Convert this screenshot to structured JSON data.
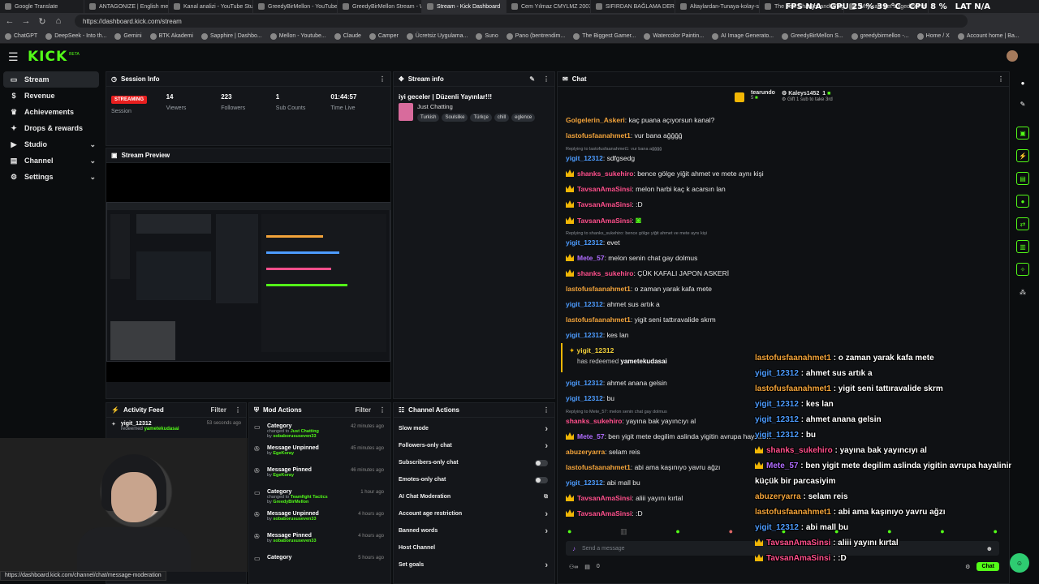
{
  "browser": {
    "tabs": [
      {
        "label": "Google Translate",
        "active": false
      },
      {
        "label": "ANTAGONIZE | English mea",
        "active": false
      },
      {
        "label": "Kanal analizi - YouTube Stud",
        "active": false
      },
      {
        "label": "GreedyBirMellon - YouTube",
        "active": false
      },
      {
        "label": "GreedyBirMellon Stream - W",
        "active": false
      },
      {
        "label": "Stream - Kick Dashboard",
        "active": true
      },
      {
        "label": "Cem Yılmaz CMYLMZ 2007",
        "active": false
      },
      {
        "label": "SIFIRDAN BAĞLAMA DERSİ",
        "active": false
      },
      {
        "label": "Altaylardan-Tunaya-kolay-s",
        "active": false
      },
      {
        "label": "The best ChatBot and Widg",
        "active": false
      },
      {
        "label": "Why cats get singed but sti",
        "active": false
      }
    ],
    "url": "https://dashboard.kick.com/stream",
    "bookmarks": [
      "ChatGPT",
      "DeepSeek - Into th...",
      "Gemini",
      "BTK Akademi",
      "Sapphire | Dashbo...",
      "Mellon - Youtube...",
      "Claude",
      "Camper",
      "Ücretsiz Uygulama...",
      "Suno",
      "Pano (bentrendim...",
      "The Biggest Gamer...",
      "Watercolor Paintin...",
      "AI Image Generato...",
      "GreedyBirMellon S...",
      "greedybirmellon -...",
      "Home / X",
      "Account home | Ba..."
    ],
    "status_url": "https://dashboard.kick.com/channel/chat/message-moderation"
  },
  "osd": {
    "fps": "FPS N/A",
    "gpu": "GPU 25 % 39 °C",
    "cpu": "CPU 8 %",
    "lat": "LAT N/A"
  },
  "app": {
    "logo": "KICK",
    "beta": "BETA"
  },
  "sidebar": {
    "items": [
      {
        "label": "Stream",
        "icon": "screen-icon",
        "active": true
      },
      {
        "label": "Revenue",
        "icon": "dollar-icon"
      },
      {
        "label": "Achievements",
        "icon": "trophy-icon"
      },
      {
        "label": "Drops & rewards",
        "icon": "gift-icon"
      },
      {
        "label": "Studio",
        "icon": "studio-icon",
        "chevron": true
      },
      {
        "label": "Channel",
        "icon": "channel-icon",
        "chevron": true
      },
      {
        "label": "Settings",
        "icon": "gear-icon",
        "chevron": true
      }
    ]
  },
  "session": {
    "title": "Session Info",
    "badge": "STREAMING",
    "session_label": "Session",
    "stats": [
      {
        "value": "14",
        "label": "Viewers"
      },
      {
        "value": "223",
        "label": "Followers"
      },
      {
        "value": "1",
        "label": "Sub Counts"
      },
      {
        "value": "01:44:57",
        "label": "Time Live"
      }
    ]
  },
  "preview": {
    "title": "Stream Preview"
  },
  "stream_info": {
    "title": "Stream info",
    "stream_title": "iyi geceler | Düzenli Yayınlar!!!",
    "category": "Just Chatting",
    "tags": [
      "Turkish",
      "Soulslike",
      "Türkçe",
      "chill",
      "eglence"
    ]
  },
  "activity_feed": {
    "title": "Activity Feed",
    "filter": "Filter",
    "items": [
      {
        "user": "yigit_12312",
        "action": "redeemed",
        "reward": "yametekudasai",
        "time": "53 seconds ago"
      }
    ]
  },
  "mod_actions": {
    "title": "Mod Actions",
    "filter": "Filter",
    "items": [
      {
        "title": "Category",
        "line1": "changed to",
        "value": "Just Chatting",
        "by": "by",
        "user": "sobaborususeven33",
        "time": "42 minutes ago"
      },
      {
        "title": "Message Unpinned",
        "line1": "",
        "value": "",
        "by": "by",
        "user": "EgeKoray",
        "time": "45 minutes ago"
      },
      {
        "title": "Message Pinned",
        "line1": "",
        "value": "",
        "by": "by",
        "user": "EgeKoray",
        "time": "46 minutes ago"
      },
      {
        "title": "Category",
        "line1": "changed to",
        "value": "Teamfight Tactics",
        "by": "by",
        "user": "GreedyBirMellon",
        "time": "1 hour ago"
      },
      {
        "title": "Message Unpinned",
        "line1": "",
        "value": "",
        "by": "by",
        "user": "sobaborususeven33",
        "time": "4 hours ago"
      },
      {
        "title": "Message Pinned",
        "line1": "",
        "value": "",
        "by": "by",
        "user": "sobaborususeven33",
        "time": "4 hours ago"
      },
      {
        "title": "Category",
        "line1": "",
        "value": "",
        "by": "",
        "user": "",
        "time": "5 hours ago"
      }
    ]
  },
  "channel_actions": {
    "title": "Channel Actions",
    "items": [
      {
        "label": "Slow mode",
        "control": "chevron"
      },
      {
        "label": "Followers-only chat",
        "control": "chevron"
      },
      {
        "label": "Subscribers-only chat",
        "control": "toggle"
      },
      {
        "label": "Emotes-only chat",
        "control": "toggle"
      },
      {
        "label": "AI Chat Moderation",
        "control": "external"
      },
      {
        "label": "Account age restriction",
        "control": "chevron"
      },
      {
        "label": "Banned words",
        "control": "chevron"
      },
      {
        "label": "Host Channel",
        "control": "none"
      },
      {
        "label": "Set goals",
        "control": "chevron"
      }
    ]
  },
  "chat": {
    "title": "Chat",
    "top_gifters": [
      {
        "name": "tearundo",
        "count": "5"
      },
      {
        "name": "Kaleys1452",
        "count": "1"
      }
    ],
    "gift_text": "Gift 1 sub to take 3rd",
    "messages": [
      {
        "crown": false,
        "user": "Golgelerin_Askeri",
        "color": "orange",
        "text": "kaç puana açıyorsun kanal?",
        "reply": ""
      },
      {
        "crown": false,
        "user": "lastofusfaanahmet1",
        "color": "orange",
        "text": "vur bana ağğğğ",
        "reply": ""
      },
      {
        "crown": false,
        "user": "yigit_12312",
        "color": "blue",
        "text": "sdfgsedg",
        "reply": "Replying to lastofusfaanahmet1: vur bana ağğğğ"
      },
      {
        "crown": true,
        "user": "shanks_sukehiro",
        "color": "pink",
        "text": "bence gölge yiğit ahmet ve mete aynı kişi",
        "reply": ""
      },
      {
        "crown": true,
        "user": "TavsanAmaSinsi",
        "color": "pink",
        "text": "melon harbi kaç k acarsın lan",
        "reply": ""
      },
      {
        "crown": true,
        "user": "TavsanAmaSinsi",
        "color": "pink",
        "text": ":D",
        "reply": ""
      },
      {
        "crown": true,
        "user": "TavsanAmaSinsi",
        "color": "pink",
        "text": "",
        "reply": ""
      },
      {
        "crown": false,
        "user": "yigit_12312",
        "color": "blue",
        "text": "evet",
        "reply": "Replying to shanks_sukehiro: bence gölge yiğit ahmet ve mete aynı kişi"
      },
      {
        "crown": true,
        "user": "Mete_57",
        "color": "purple",
        "text": "melon senin chat gay dolmus",
        "reply": ""
      },
      {
        "crown": true,
        "user": "shanks_sukehiro",
        "color": "pink",
        "text": "ÇÜK KAFALI JAPON ASKERİ",
        "reply": ""
      },
      {
        "crown": false,
        "user": "lastofusfaanahmet1",
        "color": "orange",
        "text": "o zaman yarak kafa mete",
        "reply": ""
      },
      {
        "crown": false,
        "user": "yigit_12312",
        "color": "blue",
        "text": "ahmet sus artık a",
        "reply": ""
      },
      {
        "crown": false,
        "user": "lastofusfaanahmet1",
        "color": "orange",
        "text": "yigit seni tattıravalide skrm",
        "reply": ""
      },
      {
        "crown": false,
        "user": "yigit_12312",
        "color": "blue",
        "text": "kes lan",
        "reply": ""
      }
    ],
    "redeem": {
      "user": "yigit_12312",
      "text": "has redeemed",
      "reward": "yametekudasai"
    },
    "messages2": [
      {
        "crown": false,
        "user": "yigit_12312",
        "color": "blue",
        "text": "ahmet anana gelsin",
        "reply": ""
      },
      {
        "crown": false,
        "user": "yigit_12312",
        "color": "blue",
        "text": "bu",
        "reply": ""
      },
      {
        "crown": false,
        "user": "shanks_sukehiro",
        "color": "pink",
        "text": "yayına bak yayıncıyı al",
        "reply": "Replying to Mete_57: melon senin chat gay dolmus"
      },
      {
        "crown": true,
        "user": "Mete_57",
        "color": "purple",
        "text": "ben yigit mete degilim aslinda yigitin avrupa hayalinin",
        "reply": ""
      },
      {
        "crown": false,
        "user": "abuzeryarra",
        "color": "orange",
        "text": "selam reis",
        "reply": ""
      },
      {
        "crown": false,
        "user": "lastofusfaanahmet1",
        "color": "orange",
        "text": "abi ama kaşınıyo yavru ağzı",
        "reply": ""
      },
      {
        "crown": false,
        "user": "yigit_12312",
        "color": "blue",
        "text": "abi mall bu",
        "reply": ""
      },
      {
        "crown": true,
        "user": "TavsanAmaSinsi",
        "color": "pink",
        "text": "aliii yayını kırtal",
        "reply": ""
      },
      {
        "crown": true,
        "user": "TavsanAmaSinsi",
        "color": "pink",
        "text": ":D",
        "reply": ""
      }
    ],
    "input_placeholder": "Send a message",
    "footer_count_a": "",
    "footer_count_b": "0",
    "send_label": "Chat"
  },
  "overlay": {
    "lines": [
      {
        "crown": false,
        "user": "lastofusfaanahmet1",
        "color": "orange",
        "text": ": o zaman yarak kafa mete"
      },
      {
        "crown": false,
        "user": "yigit_12312",
        "color": "blue",
        "text": ": ahmet sus artık a"
      },
      {
        "crown": false,
        "user": "lastofusfaanahmet1",
        "color": "orange",
        "text": ": yigit seni tattıravalide skrm"
      },
      {
        "crown": false,
        "user": "yigit_12312",
        "color": "blue",
        "text": ": kes lan"
      },
      {
        "crown": false,
        "user": "yigit_12312",
        "color": "blue",
        "text": ": ahmet anana gelsin"
      },
      {
        "crown": false,
        "user": "yigit_12312",
        "color": "blue",
        "text": ": bu"
      },
      {
        "crown": true,
        "user": "shanks_sukehiro",
        "color": "pink",
        "text": ": yayına bak yayıncıyı al"
      },
      {
        "crown": true,
        "user": "Mete_57",
        "color": "purple",
        "text": ": ben yigit mete degilim aslinda yigitin avrupa hayalinin"
      },
      {
        "crown": false,
        "user": "",
        "color": "orange",
        "text": "küçük bir parcasiyim"
      },
      {
        "crown": false,
        "user": "abuzeryarra",
        "color": "orange",
        "text": ": selam reis"
      },
      {
        "crown": false,
        "user": "lastofusfaanahmet1",
        "color": "orange",
        "text": ": abi ama kaşınıyo yavru ağzı"
      },
      {
        "crown": false,
        "user": "yigit_12312",
        "color": "blue",
        "text": ": abi mall bu"
      },
      {
        "crown": true,
        "user": "TavsanAmaSinsi",
        "color": "pink",
        "text": ": aliii yayını kırtal"
      },
      {
        "crown": true,
        "user": "TavsanAmaSinsi",
        "color": "pink",
        "text": ": :D"
      }
    ]
  },
  "colors": {
    "accent": "#53fc18",
    "live": "#e81f1f",
    "orange": "#f2a33a",
    "blue": "#4d9cff",
    "pink": "#ff4f8b",
    "purple": "#b06cff"
  }
}
